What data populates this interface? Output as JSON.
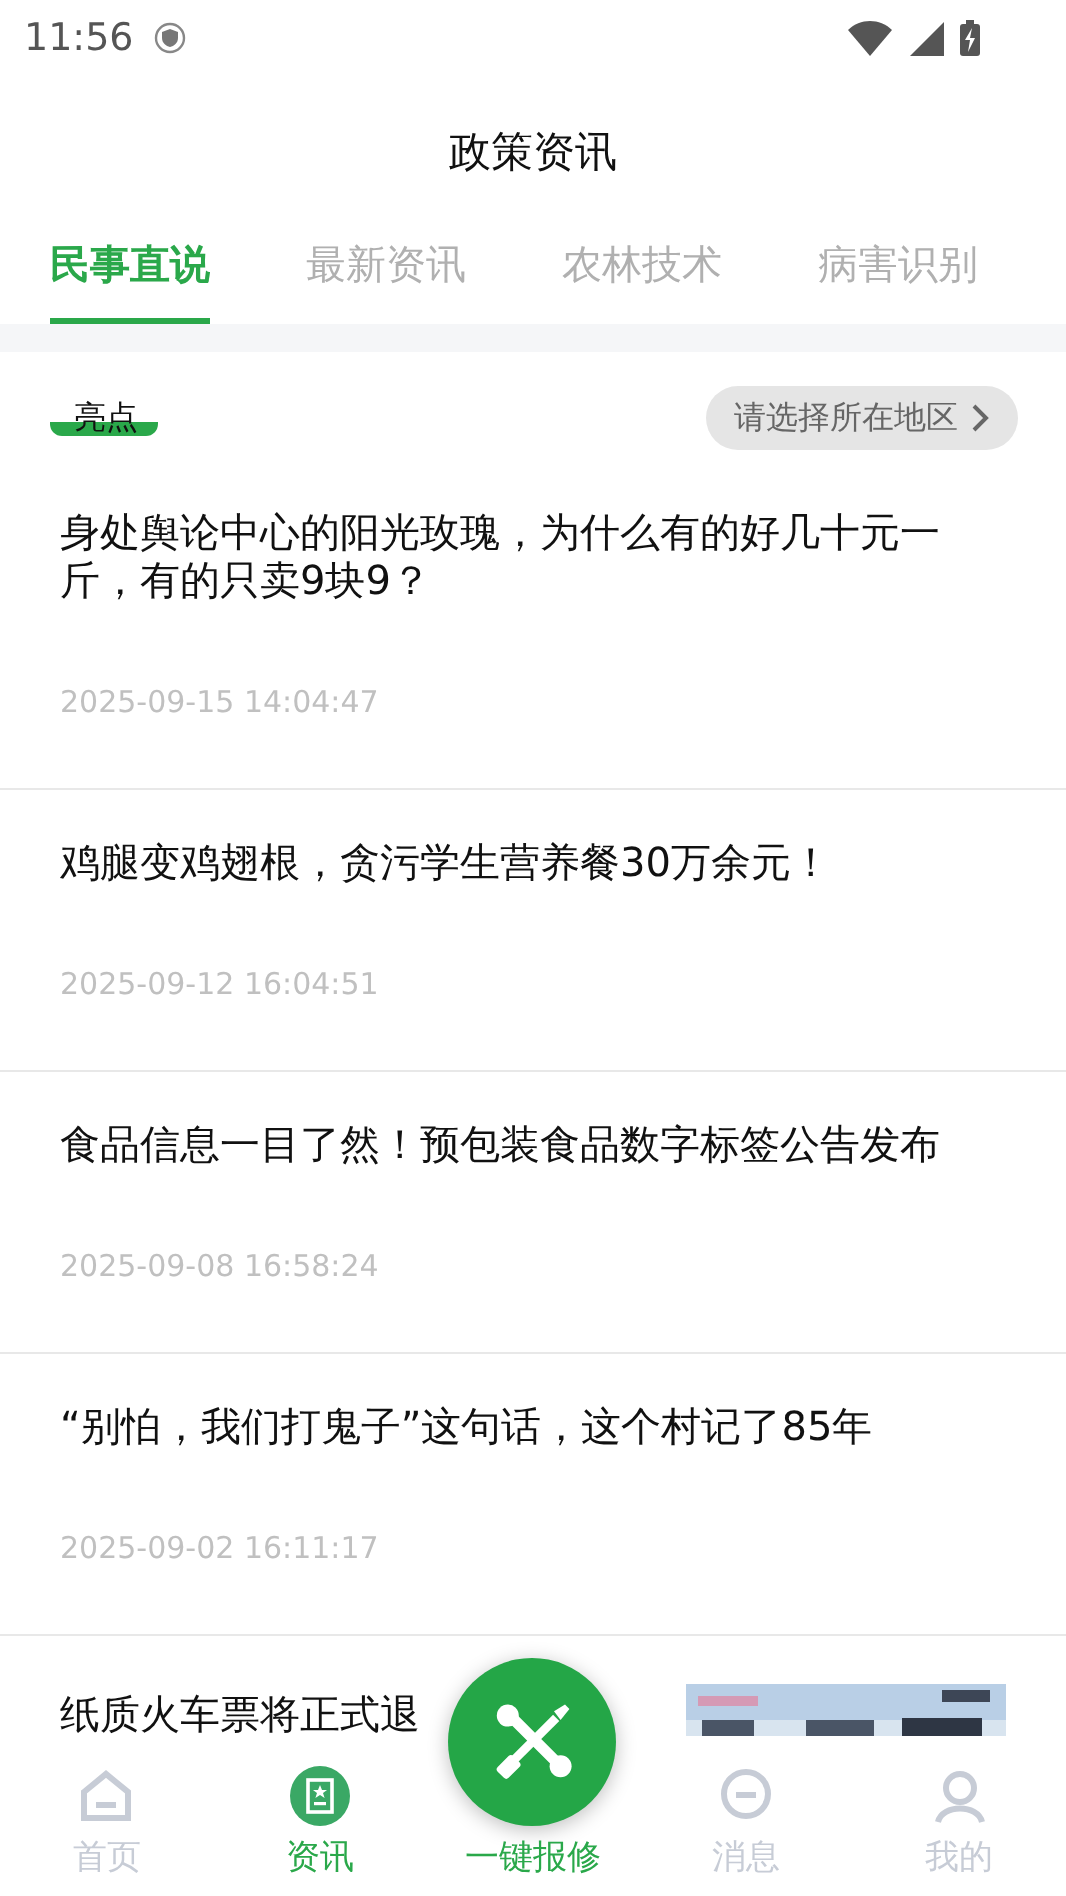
{
  "status_bar": {
    "time": "11:56"
  },
  "header": {
    "title": "政策资讯"
  },
  "tabs": [
    {
      "label": "民事直说",
      "selected": true
    },
    {
      "label": "最新资讯",
      "selected": false
    },
    {
      "label": "农林技术",
      "selected": false
    },
    {
      "label": "病害识别",
      "selected": false
    }
  ],
  "filter": {
    "tag": "亮点",
    "region_button": "请选择所在地区"
  },
  "articles": [
    {
      "title": "身处舆论中心的阳光玫瑰，为什么有的好几十元一斤，有的只卖9块9？",
      "date": "2025-09-15 14:04:47"
    },
    {
      "title": "鸡腿变鸡翅根，贪污学生营养餐30万余元！",
      "date": "2025-09-12 16:04:51"
    },
    {
      "title": "食品信息一目了然！预包装食品数字标签公告发布",
      "date": "2025-09-08 16:58:24"
    },
    {
      "title": "“别怕，我们打鬼子”这句话，这个村记了85年",
      "date": "2025-09-02 16:11:17"
    }
  ],
  "partial_article": {
    "title": "纸质火车票将正式退",
    "kind": "picture"
  },
  "bottom_nav": [
    {
      "kind": "home",
      "label": "首页",
      "selected": false
    },
    {
      "kind": "news",
      "label": "资讯",
      "selected": true
    },
    {
      "kind": "fab",
      "label": "一键报修"
    },
    {
      "kind": "chat",
      "label": "消息",
      "selected": false
    },
    {
      "kind": "user",
      "label": "我的",
      "selected": false
    }
  ]
}
